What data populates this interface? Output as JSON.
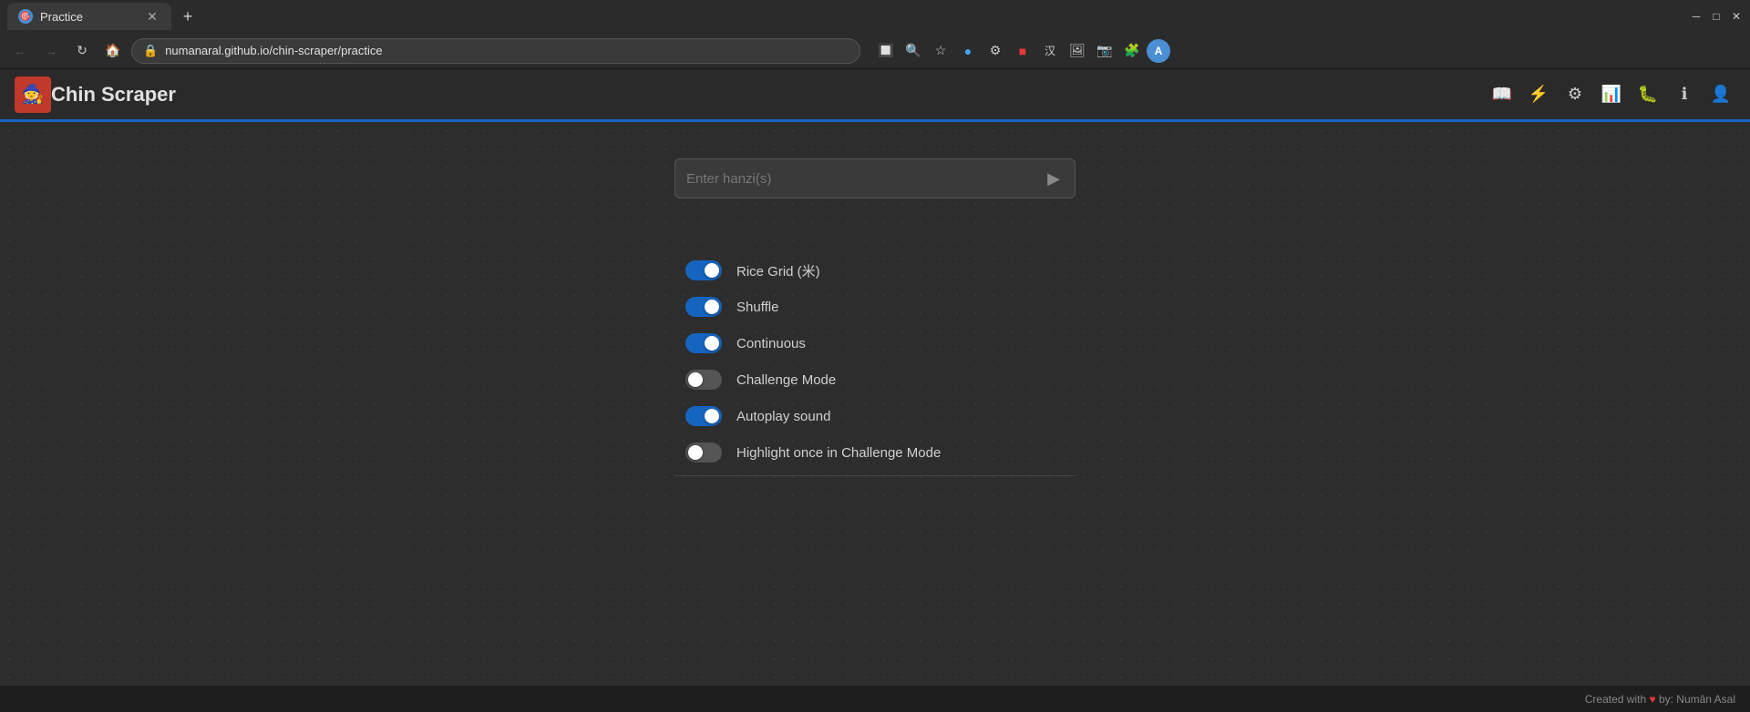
{
  "browser": {
    "tab_label": "Practice",
    "tab_favicon": "🎯",
    "url": "numanaral.github.io/chin-scraper/practice",
    "lock_icon": "🔒"
  },
  "header": {
    "app_title": "Chin Scraper",
    "logo_emoji": "🧙"
  },
  "main": {
    "input_placeholder": "Enter hanzi(s)"
  },
  "settings": {
    "title": "Settings",
    "toggles": [
      {
        "id": "rice-grid",
        "label": "Rice Grid (米)",
        "enabled": true
      },
      {
        "id": "shuffle",
        "label": "Shuffle",
        "enabled": true
      },
      {
        "id": "continuous",
        "label": "Continuous",
        "enabled": true
      },
      {
        "id": "challenge-mode",
        "label": "Challenge Mode",
        "enabled": false
      },
      {
        "id": "autoplay-sound",
        "label": "Autoplay sound",
        "enabled": true
      },
      {
        "id": "highlight-challenge",
        "label": "Highlight once in Challenge Mode",
        "enabled": false
      }
    ]
  },
  "footer": {
    "prefix": "Created with",
    "suffix": "by: Numân Asal"
  },
  "nav_icons": [
    "📖",
    "⚡",
    "⚙️",
    "📊",
    "🐛",
    "ℹ️",
    "👤"
  ],
  "browser_ext_icons": [
    "🔲",
    "🔍",
    "⭐",
    "🔵",
    "⚙️",
    "🔴",
    "汉",
    "🖼️",
    "📷",
    "🧩",
    "👤"
  ]
}
